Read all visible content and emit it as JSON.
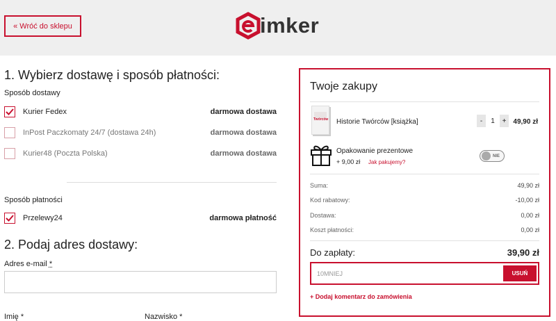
{
  "header": {
    "back_label": "« Wróć do sklepu",
    "logo_text": "imker"
  },
  "checkout": {
    "step1_title": "1. Wybierz dostawę i sposób płatności:",
    "delivery_title": "Sposób dostawy",
    "delivery_options": [
      {
        "label": "Kurier Fedex",
        "price": "darmowa dostawa",
        "checked": true
      },
      {
        "label": "InPost Paczkomaty 24/7 (dostawa 24h)",
        "price": "darmowa dostawa",
        "checked": false
      },
      {
        "label": "Kurier48 (Poczta Polska)",
        "price": "darmowa dostawa",
        "checked": false
      }
    ],
    "payment_title": "Sposób płatności",
    "payment_options": [
      {
        "label": "Przelewy24",
        "price": "darmowa płatność",
        "checked": true
      }
    ],
    "step2_title": "2. Podaj adres dostawy:",
    "email_label": "Adres e-mail",
    "first_name_label": "Imię",
    "last_name_label": "Nazwisko",
    "required_mark": "*"
  },
  "cart": {
    "title": "Twoje zakupy",
    "item": {
      "name": "Historie Twórców [książka]",
      "quantity": "1",
      "minus": "-",
      "plus": "+",
      "price": "49,90 zł",
      "cover_text": "Twórców"
    },
    "gift": {
      "name": "Opakowanie prezentowe",
      "price": "+ 9,00 zł",
      "link": "Jak pakujemy?",
      "toggle_label": "NIE"
    },
    "summary": [
      {
        "label": "Suma:",
        "value": "49,90 zł"
      },
      {
        "label": "Kod rabatowy:",
        "value": "-10,00 zł"
      },
      {
        "label": "Dostawa:",
        "value": "0,00 zł"
      },
      {
        "label": "Koszt płatności:",
        "value": "0,00 zł"
      }
    ],
    "total_label": "Do zapłaty:",
    "total_value": "39,90 zł",
    "promo_code": "10MNIEJ",
    "promo_button": "USUŃ",
    "comment_link": "+ Dodaj komentarz do zamówienia"
  },
  "colors": {
    "accent": "#c8102e"
  },
  "icons": [
    "check-icon",
    "gift-icon",
    "logo-hexagon-icon"
  ]
}
